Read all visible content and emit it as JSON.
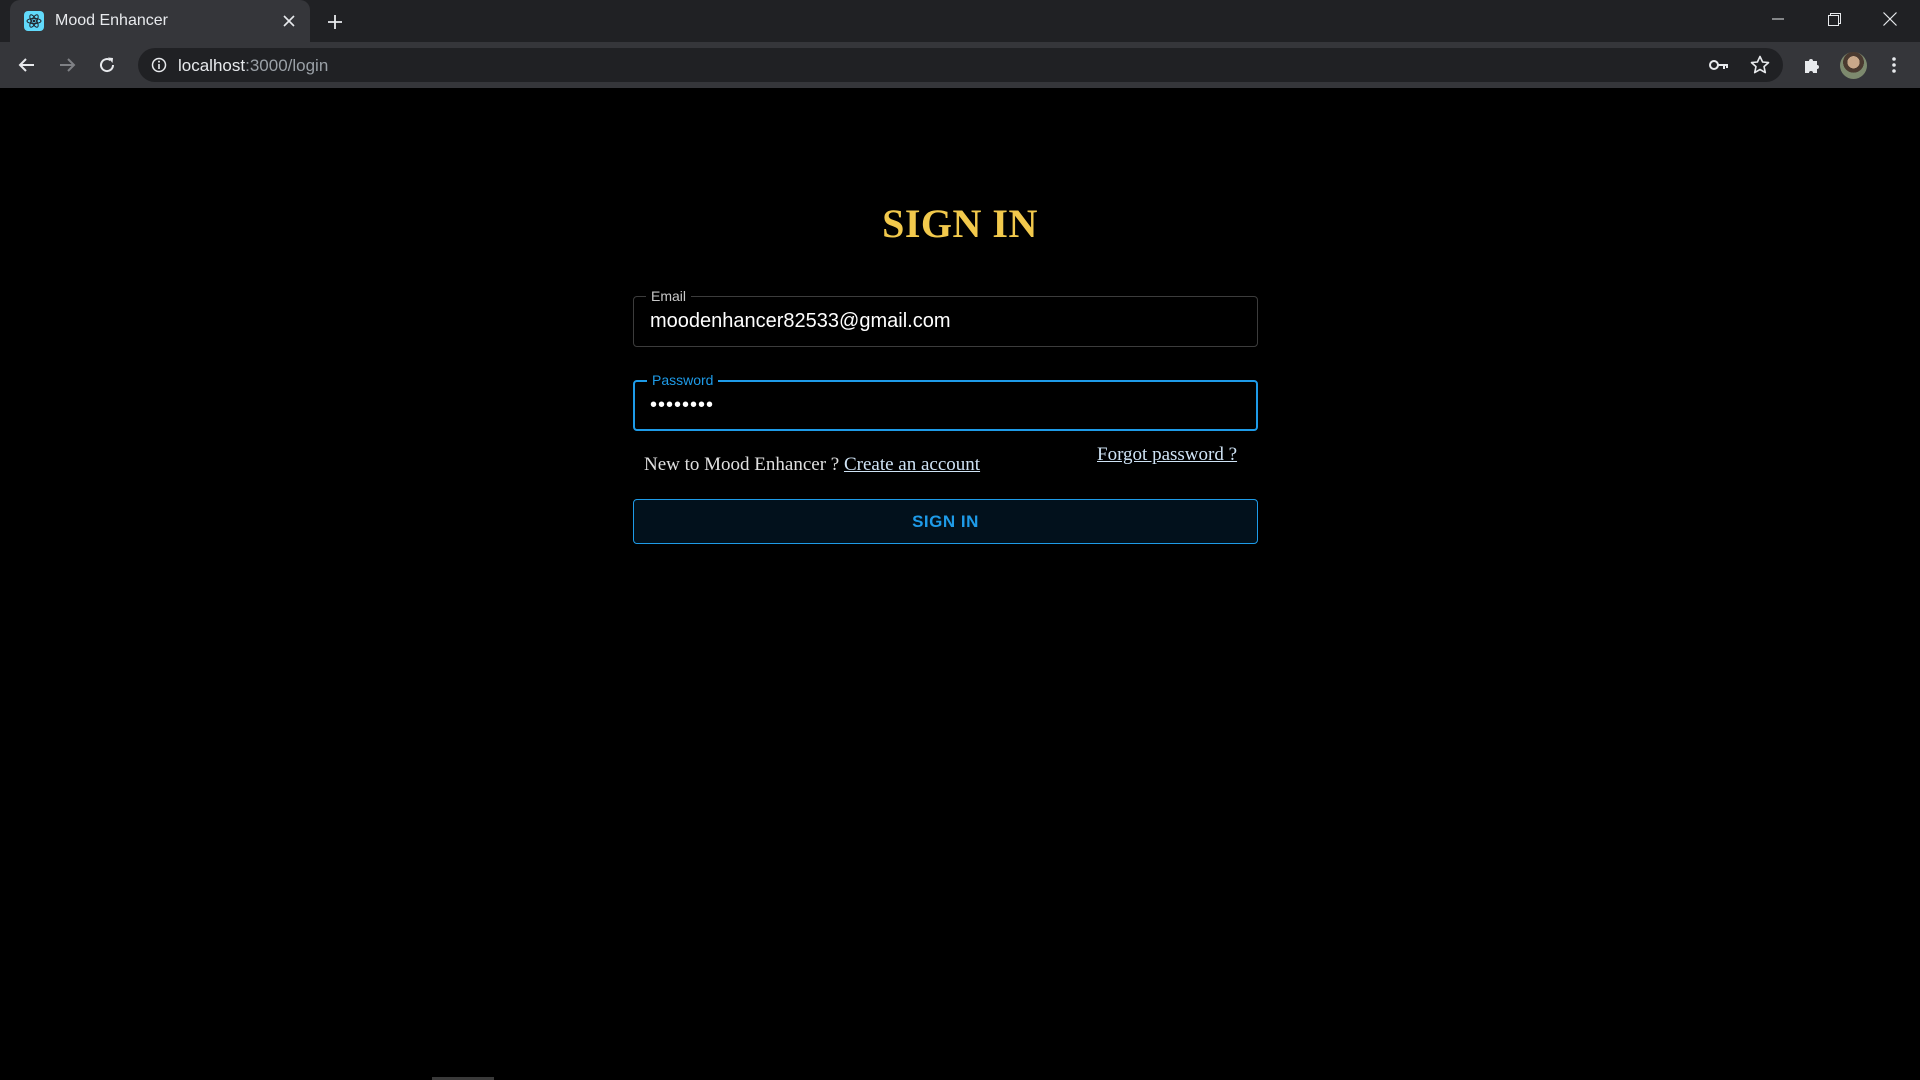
{
  "browser": {
    "tab_title": "Mood Enhancer",
    "url_host": "localhost",
    "url_path": ":3000/login"
  },
  "colors": {
    "title": "#f2c94c",
    "accent": "#1e9be8",
    "background": "#000000"
  },
  "login": {
    "title": "SIGN IN",
    "email_label": "Email",
    "email_value": "moodenhancer82533@gmail.com",
    "password_label": "Password",
    "password_value": "••••••••",
    "new_user_text": "New to Mood Enhancer ? ",
    "create_account_link": "Create an account",
    "forgot_password_link": "Forgot password ?",
    "submit_label": "SIGN IN"
  }
}
